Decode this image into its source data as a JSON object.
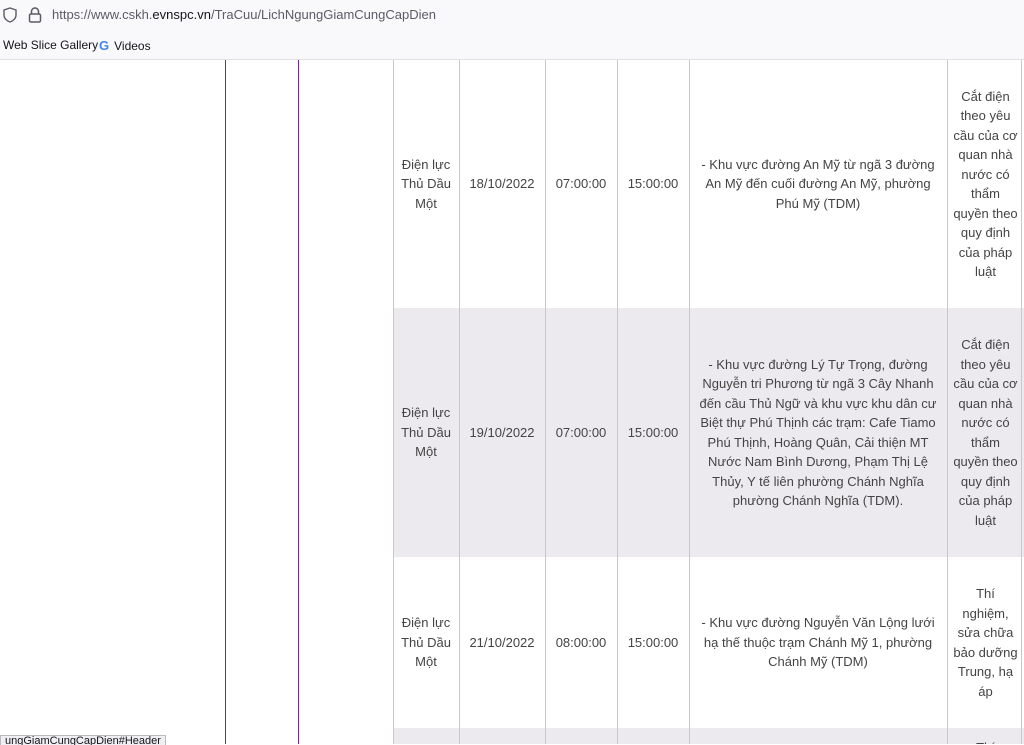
{
  "browser": {
    "url_prefix": "https://www.cskh.",
    "url_host": "evnspc.vn",
    "url_path": "/TraCuu/LichNgungGiamCungCapDien",
    "status_url": "ungGiamCungCapDien#Header"
  },
  "bookmarks": [
    {
      "label": "Web Slice Gallery",
      "icon": "web-slice-icon"
    },
    {
      "label": "Videos",
      "icon": "google-icon"
    }
  ],
  "schedule": {
    "rows": [
      {
        "unit": "Điện lực Thủ Dầu Một",
        "date": "18/10/2022",
        "start": "07:00:00",
        "end": "15:00:00",
        "area": "- Khu vực đường An Mỹ từ ngã 3 đường An Mỹ đến cuối đường An Mỹ, phường Phú Mỹ (TDM)",
        "reason": "Cắt điện theo yêu cầu của cơ quan nhà nước có thẩm quyền theo quy định của pháp luật"
      },
      {
        "unit": "Điện lực Thủ Dầu Một",
        "date": "19/10/2022",
        "start": "07:00:00",
        "end": "15:00:00",
        "area": "- Khu vực đường Lý Tự Trọng, đường Nguyễn tri Phương từ ngã 3 Cây Nhanh đến cầu Thủ Ngữ và khu vực khu dân cư Biệt thự Phú Thịnh các trạm: Cafe Tiamo Phú Thịnh, Hoàng Quân, Cải thiện MT Nước Nam Bình Dương, Phạm Thị Lệ Thủy, Y tế liên phường Chánh Nghĩa phường Chánh Nghĩa (TDM).",
        "reason": "Cắt điện theo yêu cầu của cơ quan nhà nước có thẩm quyền theo quy định của pháp luật"
      },
      {
        "unit": "Điện lực Thủ Dầu Một",
        "date": "21/10/2022",
        "start": "08:00:00",
        "end": "15:00:00",
        "area": "- Khu vực đường Nguyễn Văn Lộng lưới hạ thế thuộc trạm Chánh Mỹ 1, phường Chánh Mỹ (TDM)",
        "reason": "Thí nghiệm, sửa chữa bảo dưỡng Trung, hạ áp"
      },
      {
        "unit": "",
        "date": "",
        "start": "",
        "end": "",
        "area": "",
        "reason": "Thí"
      }
    ]
  },
  "colors": {
    "purple_border": "#6a2c91",
    "alt_row": "#edeaef",
    "grid": "#c8c8c8"
  }
}
